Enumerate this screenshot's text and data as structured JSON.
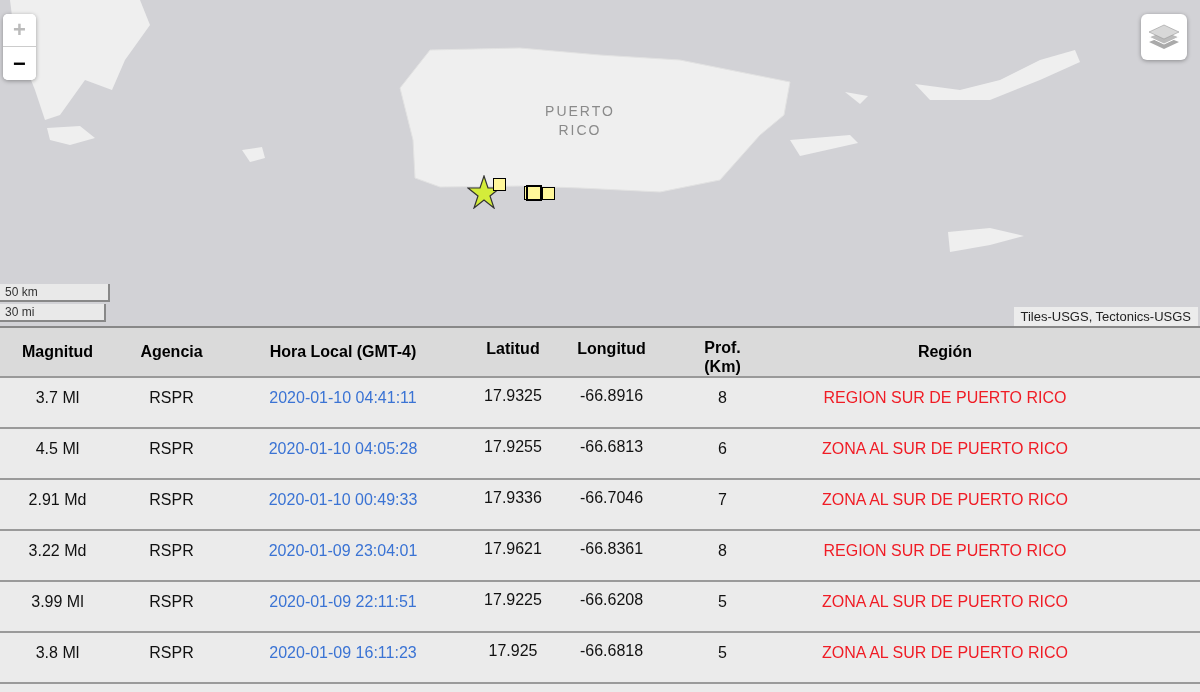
{
  "map": {
    "zoom_controls": [
      {
        "label": "+",
        "disabled": true
      },
      {
        "label": "−",
        "disabled": false
      }
    ],
    "place_label": "PUERTO RICO",
    "scale": [
      "50 km",
      "30 mi"
    ],
    "attribution": "Tiles-USGS, Tectonics-USGS"
  },
  "table": {
    "columns": [
      "Magnitud",
      "Agencia",
      "Hora Local (GMT-4)",
      "Latitud",
      "Longitud",
      "Prof. (Km)",
      "Región"
    ],
    "rows": [
      {
        "magnitude": "3.7 Ml",
        "agency": "RSPR",
        "time": "2020-01-10 04:41:11",
        "lat": "17.9325",
        "lon": "-66.8916",
        "depth": "8",
        "region": "REGION SUR DE PUERTO RICO"
      },
      {
        "magnitude": "4.5 Ml",
        "agency": "RSPR",
        "time": "2020-01-10 04:05:28",
        "lat": "17.9255",
        "lon": "-66.6813",
        "depth": "6",
        "region": "ZONA AL SUR DE PUERTO RICO"
      },
      {
        "magnitude": "2.91 Md",
        "agency": "RSPR",
        "time": "2020-01-10 00:49:33",
        "lat": "17.9336",
        "lon": "-66.7046",
        "depth": "7",
        "region": "ZONA AL SUR DE PUERTO RICO"
      },
      {
        "magnitude": "3.22 Md",
        "agency": "RSPR",
        "time": "2020-01-09 23:04:01",
        "lat": "17.9621",
        "lon": "-66.8361",
        "depth": "8",
        "region": "REGION SUR DE PUERTO RICO"
      },
      {
        "magnitude": "3.99 Ml",
        "agency": "RSPR",
        "time": "2020-01-09 22:11:51",
        "lat": "17.9225",
        "lon": "-66.6208",
        "depth": "5",
        "region": "ZONA AL SUR DE PUERTO RICO"
      },
      {
        "magnitude": "3.8 Ml",
        "agency": "RSPR",
        "time": "2020-01-09 16:11:23",
        "lat": "17.925",
        "lon": "-66.6818",
        "depth": "5",
        "region": "ZONA AL SUR DE PUERTO RICO"
      }
    ]
  }
}
